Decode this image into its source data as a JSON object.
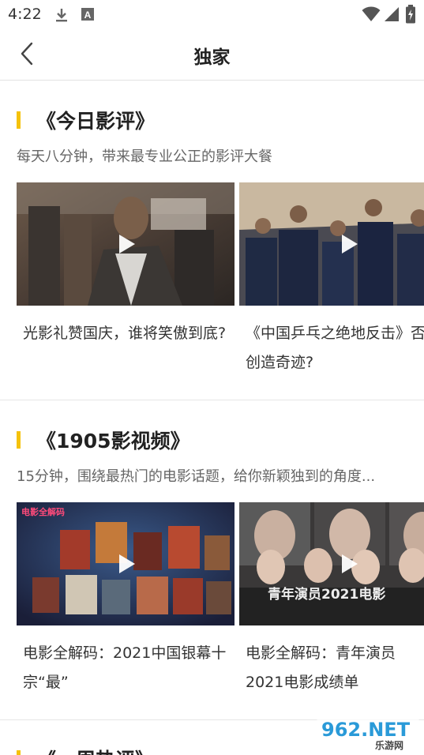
{
  "status_bar": {
    "time": "4:22",
    "icons": [
      "download-icon",
      "keyboard-a-icon",
      "wifi-icon",
      "signal-icon",
      "battery-charging-icon"
    ]
  },
  "header": {
    "title": "独家",
    "back_icon": "chevron-left-icon"
  },
  "colors": {
    "accent": "#f5c20b",
    "divider": "#e6e6e6",
    "title_text": "#222222",
    "subtitle_text": "#666666"
  },
  "sections": [
    {
      "title": "《今日影评》",
      "subtitle": "每天八分钟，带来最专业公正的影评大餐",
      "videos": [
        {
          "title": "光影礼赞国庆，谁将笑傲到底?",
          "play_icon": "play-icon"
        },
        {
          "title": "《中国乒乓之绝地反击》否创造奇迹?",
          "play_icon": "play-icon"
        }
      ]
    },
    {
      "title": "《1905影视频》",
      "subtitle": "15分钟，围绕最热门的电影话题，给你新颖独到的角度...",
      "videos": [
        {
          "title": "电影全解码：2021中国银幕十宗“最”",
          "play_icon": "play-icon",
          "thumb_caption": "电影全解码"
        },
        {
          "title": "电影全解码：青年演员2021电影成绩单",
          "play_icon": "play-icon",
          "thumb_caption": "青年演员2021电影"
        }
      ]
    },
    {
      "title": "《一周热评》"
    }
  ],
  "watermark": {
    "text": "962.NET",
    "subtext": "乐游网"
  }
}
